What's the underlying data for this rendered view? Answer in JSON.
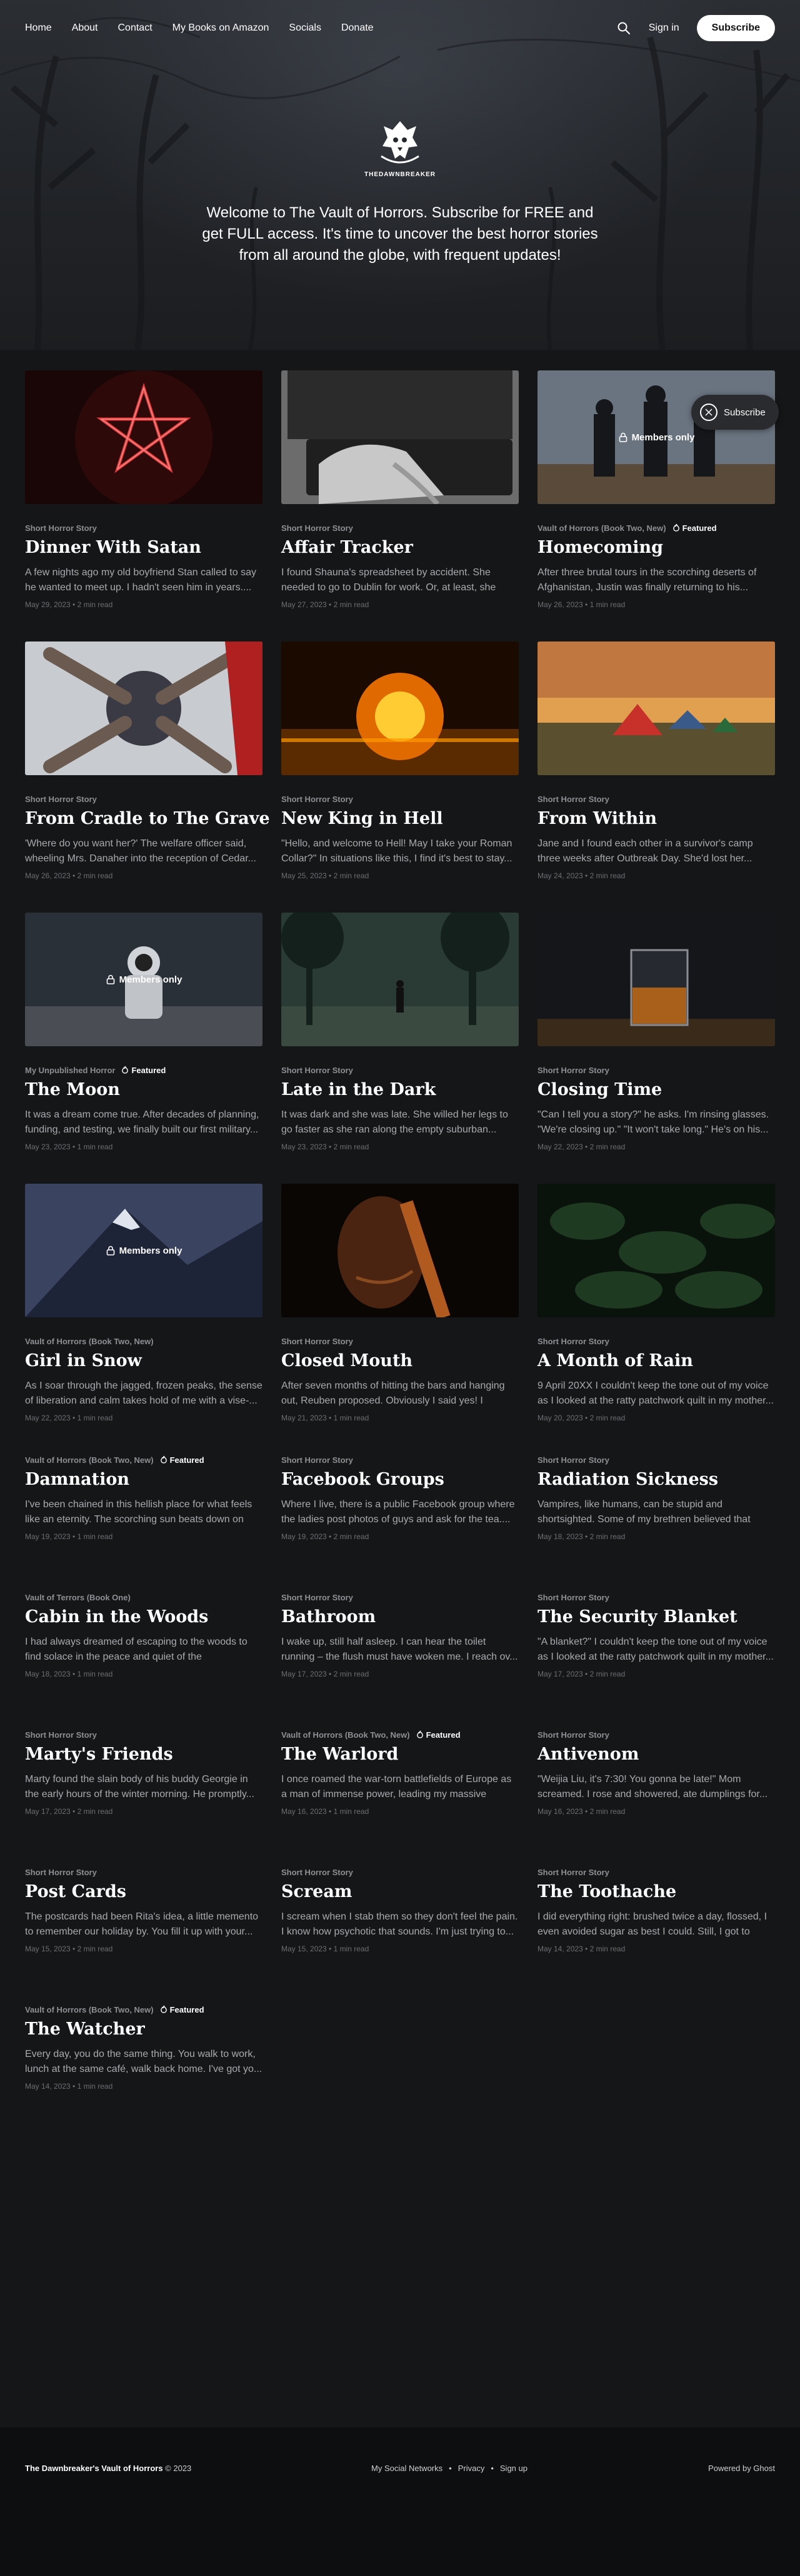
{
  "nav": {
    "links": [
      "Home",
      "About",
      "Contact",
      "My Books on Amazon",
      "Socials",
      "Donate"
    ],
    "signin": "Sign in",
    "subscribe": "Subscribe"
  },
  "hero": {
    "logo_text": "THEDAWNBREAKER",
    "description": "Welcome to The Vault of Horrors. Subscribe for FREE and get FULL access. It's time to uncover the best horror stories from all around the globe, with frequent updates!"
  },
  "members_label": "Members only",
  "featured_label": "Featured",
  "floating_subscribe": "Subscribe",
  "posts": [
    {
      "tag": "Short Horror Story",
      "title": "Dinner With Satan",
      "excerpt": "A few nights ago my old boyfriend Stan called to say he wanted to meet up. I hadn't seen him in years....",
      "date": "May 29, 2023 • 2 min read",
      "image": "pentagram"
    },
    {
      "tag": "Short Horror Story",
      "title": "Affair Tracker",
      "excerpt": "I found Shauna's spreadsheet by accident. She needed to go to Dublin for work. Or, at least, she told...",
      "date": "May 27, 2023 • 2 min read",
      "image": "laptop"
    },
    {
      "tag": "Vault of Horrors (Book Two, New)",
      "featured": true,
      "title": "Homecoming",
      "excerpt": "After three brutal tours in the scorching deserts of Afghanistan, Justin was finally returning to his...",
      "date": "May 26, 2023 • 1 min read",
      "image": "soldiers",
      "members": true
    },
    {
      "tag": "Short Horror Story",
      "title": "From Cradle to The Grave",
      "excerpt": "'Where do you want her?' The welfare officer said, wheeling Mrs. Danaher into the reception of Cedar...",
      "date": "May 26, 2023 • 2 min read",
      "image": "hands"
    },
    {
      "tag": "Short Horror Story",
      "title": "New King in Hell",
      "excerpt": "\"Hello, and welcome to Hell! May I take your Roman Collar?\" In situations like this, I find it's best to stay...",
      "date": "May 25, 2023 • 2 min read",
      "image": "sun"
    },
    {
      "tag": "Short Horror Story",
      "title": "From Within",
      "excerpt": "Jane and I found each other in a survivor's camp three weeks after Outbreak Day. She'd lost her...",
      "date": "May 24, 2023 • 2 min read",
      "image": "tents"
    },
    {
      "tag": "My Unpublished Horror",
      "featured": true,
      "title": "The Moon",
      "excerpt": "It was a dream come true. After decades of planning, funding, and testing, we finally built our first military...",
      "date": "May 23, 2023 • 1 min read",
      "image": "astronaut",
      "members": true
    },
    {
      "tag": "Short Horror Story",
      "title": "Late in the Dark",
      "excerpt": "It was dark and she was late. She willed her legs to go faster as she ran along the empty suburban...",
      "date": "May 23, 2023 • 2 min read",
      "image": "forest"
    },
    {
      "tag": "Short Horror Story",
      "title": "Closing Time",
      "excerpt": "\"Can I tell you a story?\" he asks. I'm rinsing glasses. \"We're closing up.\" \"It won't take long.\" He's on his...",
      "date": "May 22, 2023 • 2 min read",
      "image": "whiskey"
    },
    {
      "tag": "Vault of Horrors (Book Two, New)",
      "title": "Girl in Snow",
      "excerpt": "As I soar through the jagged, frozen peaks, the sense of liberation and calm takes hold of me with a vise-...",
      "date": "May 22, 2023 • 1 min read",
      "image": "mountain",
      "members": true
    },
    {
      "tag": "Short Horror Story",
      "title": "Closed Mouth",
      "excerpt": "After seven months of hitting the bars and hanging out, Reuben proposed. Obviously I said yes! I finally...",
      "date": "May 21, 2023 • 1 min read",
      "image": "face"
    },
    {
      "tag": "Short Horror Story",
      "title": "A Month of Rain",
      "excerpt": "9 April 20XX I couldn't keep the tone out of my voice as I looked at the ratty patchwork quilt in my mother...",
      "date": "May 20, 2023 • 2 min read",
      "image": "leaves"
    },
    {
      "tag": "Vault of Horrors (Book Two, New)",
      "featured": true,
      "title": "Damnation",
      "excerpt": "I've been chained in this hellish place for what feels like an eternity. The scorching sun beats down on m...",
      "date": "May 19, 2023 • 1 min read"
    },
    {
      "tag": "Short Horror Story",
      "title": "Facebook Groups",
      "excerpt": "Where I live, there is a public Facebook group where the ladies post photos of guys and ask for the tea....",
      "date": "May 19, 2023 • 2 min read"
    },
    {
      "tag": "Short Horror Story",
      "title": "Radiation Sickness",
      "excerpt": "Vampires, like humans, can be stupid and shortsighted. Some of my brethren believed that our...",
      "date": "May 18, 2023 • 2 min read"
    },
    {
      "tag": "Vault of Terrors (Book One)",
      "title": "Cabin in the Woods",
      "excerpt": "I had always dreamed of escaping to the woods to find solace in the peace and quiet of the wilderness....",
      "date": "May 18, 2023 • 1 min read"
    },
    {
      "tag": "Short Horror Story",
      "title": "Bathroom",
      "excerpt": "I wake up, still half asleep. I can hear the toilet running – the flush must have woken me. I reach ov...",
      "date": "May 17, 2023 • 2 min read"
    },
    {
      "tag": "Short Horror Story",
      "title": "The Security Blanket",
      "excerpt": "\"A blanket?\" I couldn't keep the tone out of my voice as I looked at the ratty patchwork quilt in my mother...",
      "date": "May 17, 2023 • 2 min read"
    },
    {
      "tag": "Short Horror Story",
      "title": "Marty's Friends",
      "excerpt": "Marty found the slain body of his buddy Georgie in the early hours of the winter morning. He promptly...",
      "date": "May 17, 2023 • 2 min read"
    },
    {
      "tag": "Vault of Horrors (Book Two, New)",
      "featured": true,
      "title": "The Warlord",
      "excerpt": "I once roamed the war-torn battlefields of Europe as a man of immense power, leading my massive army...",
      "date": "May 16, 2023 • 1 min read"
    },
    {
      "tag": "Short Horror Story",
      "title": "Antivenom",
      "excerpt": "\"Weijia Liu, it's 7:30! You gonna be late!\" Mom screamed. I rose and showered, ate dumplings for...",
      "date": "May 16, 2023 • 2 min read"
    },
    {
      "tag": "Short Horror Story",
      "title": "Post Cards",
      "excerpt": "The postcards had been Rita's idea, a little memento to remember our holiday by. You fill it up with your...",
      "date": "May 15, 2023 • 2 min read"
    },
    {
      "tag": "Short Horror Story",
      "title": "Scream",
      "excerpt": "I scream when I stab them so they don't feel the pain. I know how psychotic that sounds. I'm just trying to...",
      "date": "May 15, 2023 • 1 min read"
    },
    {
      "tag": "Short Horror Story",
      "title": "The Toothache",
      "excerpt": "I did everything right: brushed twice a day, flossed, I even avoided sugar as best I could. Still, I got to thirt...",
      "date": "May 14, 2023 • 2 min read"
    },
    {
      "tag": "Vault of Horrors (Book Two, New)",
      "featured": true,
      "title": "The Watcher",
      "excerpt": "Every day, you do the same thing. You walk to work, lunch at the same café, walk back home. I've got yo...",
      "date": "May 14, 2023 • 1 min read"
    }
  ],
  "footer": {
    "brand": "The Dawnbreaker's Vault of Horrors",
    "year": "© 2023",
    "links": [
      "My Social Networks",
      "Privacy",
      "Sign up"
    ],
    "separator": "•",
    "powered": "Powered by Ghost"
  }
}
